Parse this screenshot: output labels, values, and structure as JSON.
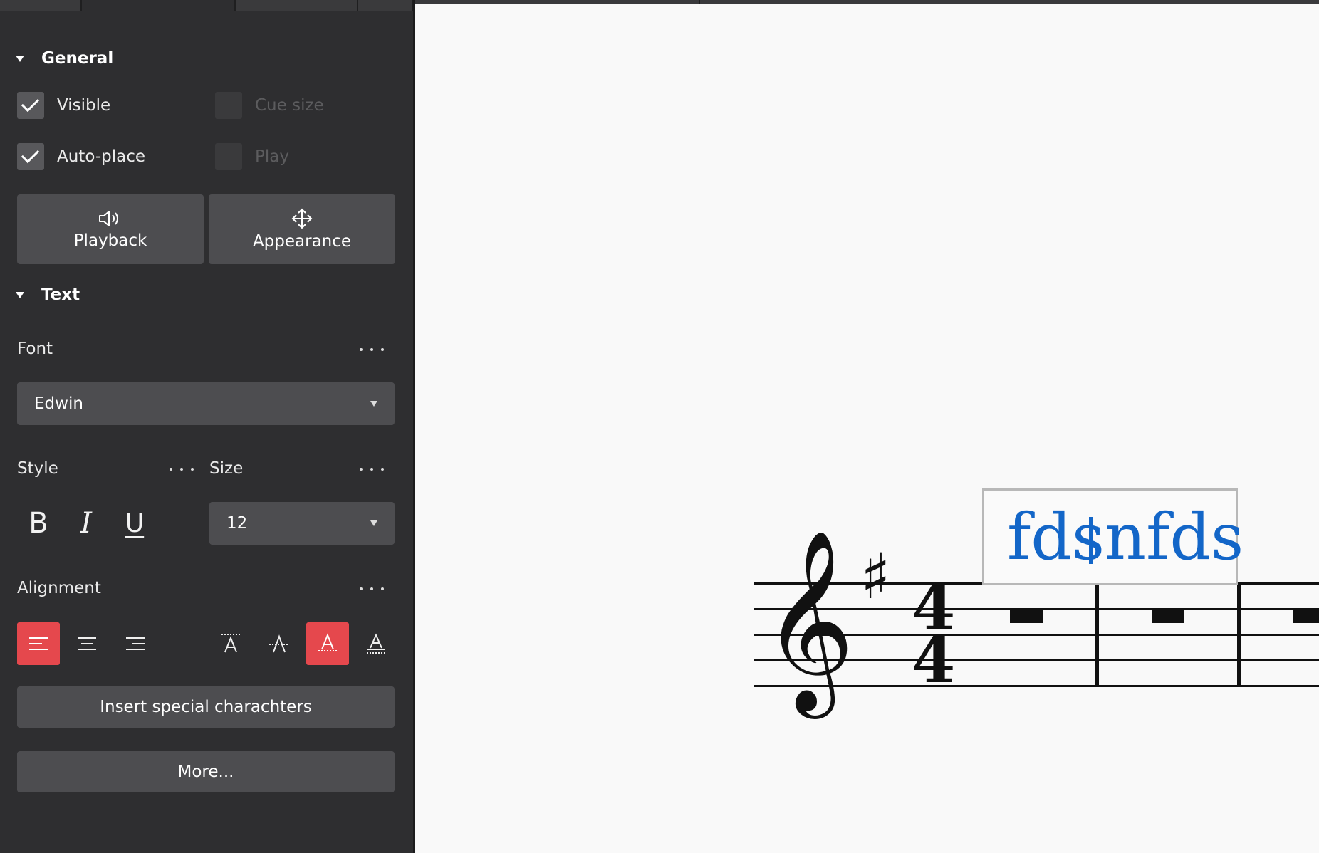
{
  "panel": {
    "general": {
      "title": "General",
      "visible_label": "Visible",
      "visible_checked": true,
      "cue_size_label": "Cue size",
      "cue_size_enabled": false,
      "auto_place_label": "Auto-place",
      "auto_place_checked": true,
      "play_label": "Play",
      "play_enabled": false,
      "playback_button": "Playback",
      "appearance_button": "Appearance"
    },
    "text": {
      "title": "Text",
      "font_label": "Font",
      "font_value": "Edwin",
      "style_label": "Style",
      "size_label": "Size",
      "size_value": "12",
      "bold_glyph": "B",
      "italic_glyph": "I",
      "underline_glyph": "U",
      "alignment_label": "Alignment",
      "horizontal_alignment_selected": "left",
      "vertical_alignment_selected": "baseline",
      "insert_special_button": "Insert special charachters",
      "more_button": "More..."
    }
  },
  "score": {
    "text_object": "fdsnfds",
    "cursor_after": "fds",
    "time_signature_top": "4",
    "time_signature_bottom": "4",
    "key_signature": "♯",
    "clef": "𝄞"
  },
  "colors": {
    "panel_bg": "#2e2e30",
    "accent": "#e5484d",
    "text_object": "#1366c8"
  }
}
